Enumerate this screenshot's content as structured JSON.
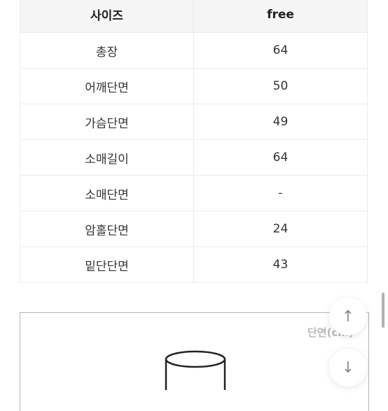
{
  "table": {
    "header": {
      "label": "사이즈",
      "value": "free"
    },
    "rows": [
      {
        "label": "총장",
        "value": "64"
      },
      {
        "label": "어깨단면",
        "value": "50"
      },
      {
        "label": "가슴단면",
        "value": "49"
      },
      {
        "label": "소매길이",
        "value": "64"
      },
      {
        "label": "소매단면",
        "value": "-"
      },
      {
        "label": "암홀단면",
        "value": "24"
      },
      {
        "label": "밑단단면",
        "value": "43"
      }
    ]
  },
  "diagram": {
    "label": "단면(cm)"
  },
  "buttons": {
    "up_icon": "↑",
    "down_icon": "↓"
  }
}
